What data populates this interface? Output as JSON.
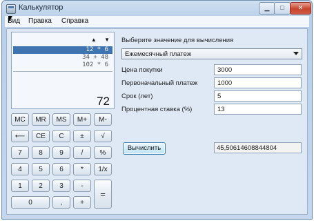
{
  "window": {
    "title": "Калькулятор"
  },
  "menu": [
    {
      "label": "Вид"
    },
    {
      "label": "Правка"
    },
    {
      "label": "Справка"
    }
  ],
  "history": {
    "up_arrow": "▲",
    "down_arrow": "▼",
    "entries": [
      "12 * 6",
      "34 + 48",
      "102 * 6"
    ],
    "selected_index": 0
  },
  "display": {
    "value": "72"
  },
  "keys": {
    "mc": "MC",
    "mr": "MR",
    "ms": "MS",
    "mplus": "M+",
    "mminus": "M-",
    "back": "⟵",
    "ce": "CE",
    "c": "C",
    "plusminus": "±",
    "sqrt": "√",
    "n7": "7",
    "n8": "8",
    "n9": "9",
    "div": "/",
    "pct": "%",
    "n4": "4",
    "n5": "5",
    "n6": "6",
    "mul": "*",
    "inv": "1/x",
    "n1": "1",
    "n2": "2",
    "n3": "3",
    "minus": "-",
    "eq": "=",
    "n0": "0",
    "dot": ",",
    "plus": "+"
  },
  "mortgage": {
    "select_label": "Выберите значение для вычисления",
    "selected_option": "Ежемесячный платеж",
    "fields": [
      {
        "label": "Цена покупки",
        "value": "3000"
      },
      {
        "label": "Первоначальный платеж",
        "value": "1000"
      },
      {
        "label": "Срок (лет)",
        "value": "5"
      },
      {
        "label": "Процентная ставка (%)",
        "value": "13"
      }
    ],
    "calculate_label": "Вычислить",
    "result": "45,50614608844804"
  }
}
